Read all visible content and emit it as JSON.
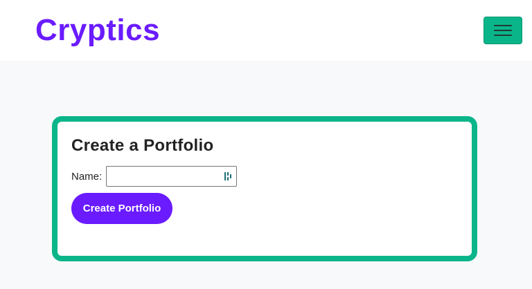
{
  "navbar": {
    "brand": "Cryptics",
    "menu_icon": "hamburger-menu-icon"
  },
  "colors": {
    "brand": "#6a1bff",
    "accent": "#0bb58a",
    "page_bg": "#f8f9fa"
  },
  "form": {
    "title": "Create a Portfolio",
    "name_label": "Name:",
    "name_value": "",
    "name_placeholder": "",
    "field_icon": "password-manager-icon",
    "submit_label": "Create Portfolio"
  }
}
